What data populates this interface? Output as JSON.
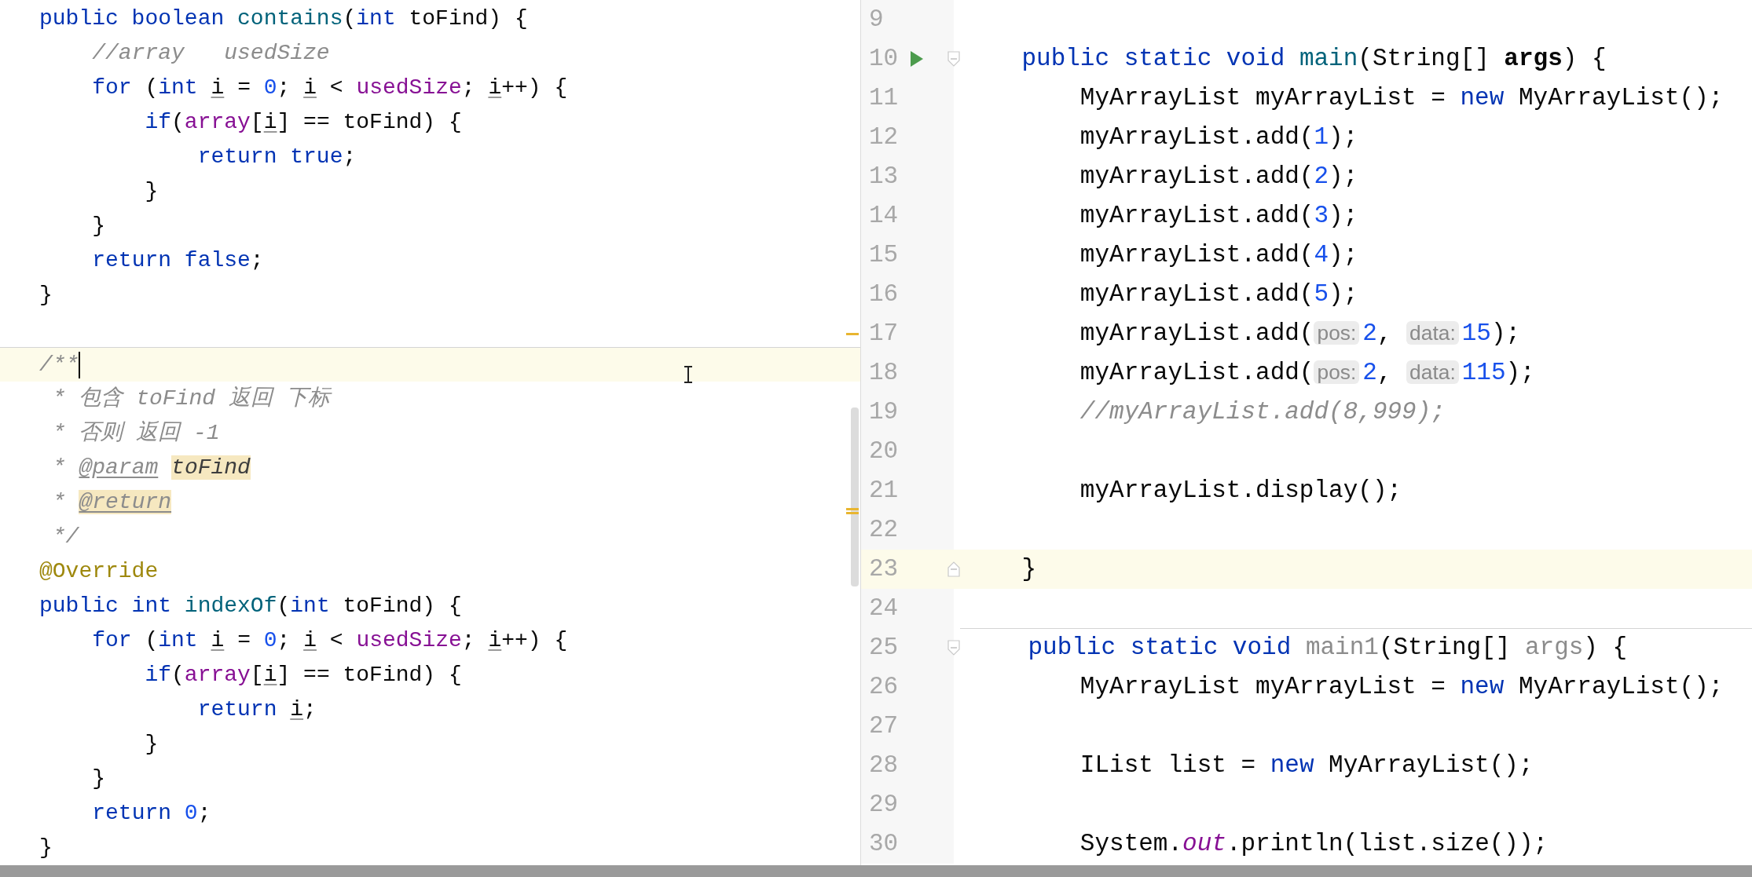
{
  "left_editor": {
    "lines": [
      {
        "current": false,
        "caret": false,
        "separator_above": false,
        "tokens": [
          {
            "kind": "kw",
            "text": "public boolean "
          },
          {
            "kind": "decl",
            "text": "contains"
          },
          {
            "kind": "plain",
            "text": "("
          },
          {
            "kind": "kw",
            "text": "int"
          },
          {
            "kind": "plain",
            "text": " toFind) {"
          }
        ]
      },
      {
        "current": false,
        "caret": false,
        "separator_above": false,
        "tokens": [
          {
            "kind": "comment",
            "text": "    //array   usedSize"
          }
        ]
      },
      {
        "current": false,
        "caret": false,
        "separator_above": false,
        "tokens": [
          {
            "kind": "kw",
            "text": "    for"
          },
          {
            "kind": "plain",
            "text": " ("
          },
          {
            "kind": "kw",
            "text": "int"
          },
          {
            "kind": "local",
            "text": " i"
          },
          {
            "kind": "plain",
            "text": " = "
          },
          {
            "kind": "num",
            "text": "0"
          },
          {
            "kind": "plain",
            "text": "; "
          },
          {
            "kind": "local",
            "text": "i"
          },
          {
            "kind": "plain",
            "text": " < "
          },
          {
            "kind": "field",
            "text": "usedSize"
          },
          {
            "kind": "plain",
            "text": "; "
          },
          {
            "kind": "local",
            "text": "i"
          },
          {
            "kind": "plain",
            "text": "++) {"
          }
        ]
      },
      {
        "current": false,
        "caret": false,
        "separator_above": false,
        "tokens": [
          {
            "kind": "kw",
            "text": "        if"
          },
          {
            "kind": "plain",
            "text": "("
          },
          {
            "kind": "field",
            "text": "array"
          },
          {
            "kind": "plain",
            "text": "["
          },
          {
            "kind": "local",
            "text": "i"
          },
          {
            "kind": "plain",
            "text": "] == toFind) {"
          }
        ]
      },
      {
        "current": false,
        "caret": false,
        "separator_above": false,
        "tokens": [
          {
            "kind": "kw",
            "text": "            return true"
          },
          {
            "kind": "plain",
            "text": ";"
          }
        ]
      },
      {
        "current": false,
        "caret": false,
        "separator_above": false,
        "tokens": [
          {
            "kind": "plain",
            "text": "        }"
          }
        ]
      },
      {
        "current": false,
        "caret": false,
        "separator_above": false,
        "tokens": [
          {
            "kind": "plain",
            "text": "    }"
          }
        ]
      },
      {
        "current": false,
        "caret": false,
        "separator_above": false,
        "tokens": [
          {
            "kind": "kw",
            "text": "    return false"
          },
          {
            "kind": "plain",
            "text": ";"
          }
        ]
      },
      {
        "current": false,
        "caret": false,
        "separator_above": false,
        "tokens": [
          {
            "kind": "plain",
            "text": "}"
          }
        ]
      },
      {
        "current": false,
        "caret": false,
        "separator_above": false
      },
      {
        "current": true,
        "caret": true,
        "separator_above": true,
        "tokens": [
          {
            "kind": "doc",
            "text": "/**"
          }
        ]
      },
      {
        "current": false,
        "caret": false,
        "separator_above": false,
        "tokens": [
          {
            "kind": "doc",
            "text": " * 包含 toFind 返回 下标"
          }
        ]
      },
      {
        "current": false,
        "caret": false,
        "separator_above": false,
        "tokens": [
          {
            "kind": "doc",
            "text": " * 否则 返回 -1"
          }
        ]
      },
      {
        "current": false,
        "caret": false,
        "separator_above": false,
        "tokens": [
          {
            "kind": "doc",
            "text": " *"
          },
          {
            "kind": "doc-tag",
            "text": " @param"
          },
          {
            "kind": "doc-match",
            "text": " toFind"
          }
        ]
      },
      {
        "current": false,
        "caret": false,
        "separator_above": false,
        "tokens": [
          {
            "kind": "doc",
            "text": " *"
          },
          {
            "kind": "doc-tag-match",
            "text": " @return"
          }
        ]
      },
      {
        "current": false,
        "caret": false,
        "separator_above": false,
        "tokens": [
          {
            "kind": "doc",
            "text": " */"
          }
        ]
      },
      {
        "current": false,
        "caret": false,
        "separator_above": false,
        "tokens": [
          {
            "kind": "annotation",
            "text": "@Override"
          }
        ]
      },
      {
        "current": false,
        "caret": false,
        "separator_above": false,
        "tokens": [
          {
            "kind": "kw",
            "text": "public int "
          },
          {
            "kind": "decl",
            "text": "indexOf"
          },
          {
            "kind": "plain",
            "text": "("
          },
          {
            "kind": "kw",
            "text": "int"
          },
          {
            "kind": "plain",
            "text": " toFind) {"
          }
        ]
      },
      {
        "current": false,
        "caret": false,
        "separator_above": false,
        "tokens": [
          {
            "kind": "kw",
            "text": "    for"
          },
          {
            "kind": "plain",
            "text": " ("
          },
          {
            "kind": "kw",
            "text": "int"
          },
          {
            "kind": "local",
            "text": " i"
          },
          {
            "kind": "plain",
            "text": " = "
          },
          {
            "kind": "num",
            "text": "0"
          },
          {
            "kind": "plain",
            "text": "; "
          },
          {
            "kind": "local",
            "text": "i"
          },
          {
            "kind": "plain",
            "text": " < "
          },
          {
            "kind": "field",
            "text": "usedSize"
          },
          {
            "kind": "plain",
            "text": "; "
          },
          {
            "kind": "local",
            "text": "i"
          },
          {
            "kind": "plain",
            "text": "++) {"
          }
        ]
      },
      {
        "current": false,
        "caret": false,
        "separator_above": false,
        "tokens": [
          {
            "kind": "kw",
            "text": "        if"
          },
          {
            "kind": "plain",
            "text": "("
          },
          {
            "kind": "field",
            "text": "array"
          },
          {
            "kind": "plain",
            "text": "["
          },
          {
            "kind": "local",
            "text": "i"
          },
          {
            "kind": "plain",
            "text": "] == toFind) {"
          }
        ]
      },
      {
        "current": false,
        "caret": false,
        "separator_above": false,
        "tokens": [
          {
            "kind": "kw",
            "text": "            return"
          },
          {
            "kind": "local",
            "text": " i"
          },
          {
            "kind": "plain",
            "text": ";"
          }
        ]
      },
      {
        "current": false,
        "caret": false,
        "separator_above": false,
        "tokens": [
          {
            "kind": "plain",
            "text": "        }"
          }
        ]
      },
      {
        "current": false,
        "caret": false,
        "separator_above": false,
        "tokens": [
          {
            "kind": "plain",
            "text": "    }"
          }
        ]
      },
      {
        "current": false,
        "caret": false,
        "separator_above": false,
        "tokens": [
          {
            "kind": "kw",
            "text": "    return"
          },
          {
            "kind": "num",
            "text": " 0"
          },
          {
            "kind": "plain",
            "text": ";"
          }
        ]
      },
      {
        "current": false,
        "caret": false,
        "separator_above": false,
        "tokens": [
          {
            "kind": "plain",
            "text": "}"
          }
        ]
      }
    ]
  },
  "right_editor": {
    "lines": [
      {
        "number": "9",
        "current": false,
        "separator_above": false
      },
      {
        "number": "10",
        "current": false,
        "separator_above": false,
        "gutter_icons": [
          {
            "kind": "run"
          },
          {
            "kind": "fold-start"
          }
        ],
        "tokens": [
          {
            "kind": "kw",
            "text": "    public static void"
          },
          {
            "kind": "decl",
            "text": " main"
          },
          {
            "kind": "plain",
            "text": "(String[] "
          },
          {
            "kind": "param",
            "text": "args"
          },
          {
            "kind": "plain",
            "text": ") {"
          }
        ]
      },
      {
        "number": "11",
        "current": false,
        "separator_above": false,
        "tokens": [
          {
            "kind": "plain",
            "text": "        MyArrayList myArrayList = "
          },
          {
            "kind": "kw",
            "text": "new"
          },
          {
            "kind": "plain",
            "text": " MyArrayList();"
          }
        ]
      },
      {
        "number": "12",
        "current": false,
        "separator_above": false,
        "tokens": [
          {
            "kind": "plain",
            "text": "        myArrayList.add("
          },
          {
            "kind": "num",
            "text": "1"
          },
          {
            "kind": "plain",
            "text": ");"
          }
        ]
      },
      {
        "number": "13",
        "current": false,
        "separator_above": false,
        "tokens": [
          {
            "kind": "plain",
            "text": "        myArrayList.add("
          },
          {
            "kind": "num",
            "text": "2"
          },
          {
            "kind": "plain",
            "text": ");"
          }
        ]
      },
      {
        "number": "14",
        "current": false,
        "separator_above": false,
        "tokens": [
          {
            "kind": "plain",
            "text": "        myArrayList.add("
          },
          {
            "kind": "num",
            "text": "3"
          },
          {
            "kind": "plain",
            "text": ");"
          }
        ]
      },
      {
        "number": "15",
        "current": false,
        "separator_above": false,
        "tokens": [
          {
            "kind": "plain",
            "text": "        myArrayList.add("
          },
          {
            "kind": "num",
            "text": "4"
          },
          {
            "kind": "plain",
            "text": ");"
          }
        ]
      },
      {
        "number": "16",
        "current": false,
        "separator_above": false,
        "tokens": [
          {
            "kind": "plain",
            "text": "        myArrayList.add("
          },
          {
            "kind": "num",
            "text": "5"
          },
          {
            "kind": "plain",
            "text": ");"
          }
        ]
      },
      {
        "number": "17",
        "current": false,
        "separator_above": false,
        "tokens": [
          {
            "kind": "plain",
            "text": "        myArrayList.add("
          },
          {
            "kind": "hint",
            "text": "pos:"
          },
          {
            "kind": "num",
            "text": "2"
          },
          {
            "kind": "plain",
            "text": ","
          },
          {
            "kind": "hint",
            "text": " data:"
          },
          {
            "kind": "num",
            "text": "15"
          },
          {
            "kind": "plain",
            "text": ");"
          }
        ]
      },
      {
        "number": "18",
        "current": false,
        "separator_above": false,
        "tokens": [
          {
            "kind": "plain",
            "text": "        myArrayList.add("
          },
          {
            "kind": "hint",
            "text": "pos:"
          },
          {
            "kind": "num",
            "text": "2"
          },
          {
            "kind": "plain",
            "text": ","
          },
          {
            "kind": "hint",
            "text": " data:"
          },
          {
            "kind": "num",
            "text": "115"
          },
          {
            "kind": "plain",
            "text": ");"
          }
        ]
      },
      {
        "number": "19",
        "current": false,
        "separator_above": false,
        "tokens": [
          {
            "kind": "comment",
            "text": "        //myArrayList.add(8,999);"
          }
        ]
      },
      {
        "number": "20",
        "current": false,
        "separator_above": false
      },
      {
        "number": "21",
        "current": false,
        "separator_above": false,
        "tokens": [
          {
            "kind": "plain",
            "text": "        myArrayList.display();"
          }
        ]
      },
      {
        "number": "22",
        "current": false,
        "separator_above": false
      },
      {
        "number": "23",
        "current": true,
        "separator_above": false,
        "gutter_icons": [
          {
            "kind": "fold-end"
          }
        ],
        "tokens": [
          {
            "kind": "plain",
            "text": "    }"
          }
        ]
      },
      {
        "number": "24",
        "current": false,
        "separator_above": false
      },
      {
        "number": "25",
        "current": false,
        "separator_above": true,
        "gutter_icons": [
          {
            "kind": "fold-start"
          }
        ],
        "tokens": [
          {
            "kind": "kw",
            "text": "    public static void"
          },
          {
            "kind": "unused",
            "text": " main1"
          },
          {
            "kind": "plain",
            "text": "(String[] "
          },
          {
            "kind": "unused",
            "text": "args"
          },
          {
            "kind": "plain",
            "text": ") {"
          }
        ]
      },
      {
        "number": "26",
        "current": false,
        "separator_above": false,
        "tokens": [
          {
            "kind": "plain",
            "text": "        MyArrayList myArrayList = "
          },
          {
            "kind": "kw",
            "text": "new"
          },
          {
            "kind": "plain",
            "text": " MyArrayList();"
          }
        ]
      },
      {
        "number": "27",
        "current": false,
        "separator_above": false
      },
      {
        "number": "28",
        "current": false,
        "separator_above": false,
        "tokens": [
          {
            "kind": "plain",
            "text": "        IList list = "
          },
          {
            "kind": "kw",
            "text": "new"
          },
          {
            "kind": "plain",
            "text": " MyArrayList();"
          }
        ]
      },
      {
        "number": "29",
        "current": false,
        "separator_above": false
      },
      {
        "number": "30",
        "current": false,
        "separator_above": false,
        "tokens": [
          {
            "kind": "plain",
            "text": "        System."
          },
          {
            "kind": "static",
            "text": "out"
          },
          {
            "kind": "plain",
            "text": ".println(list.size());"
          }
        ]
      }
    ]
  }
}
